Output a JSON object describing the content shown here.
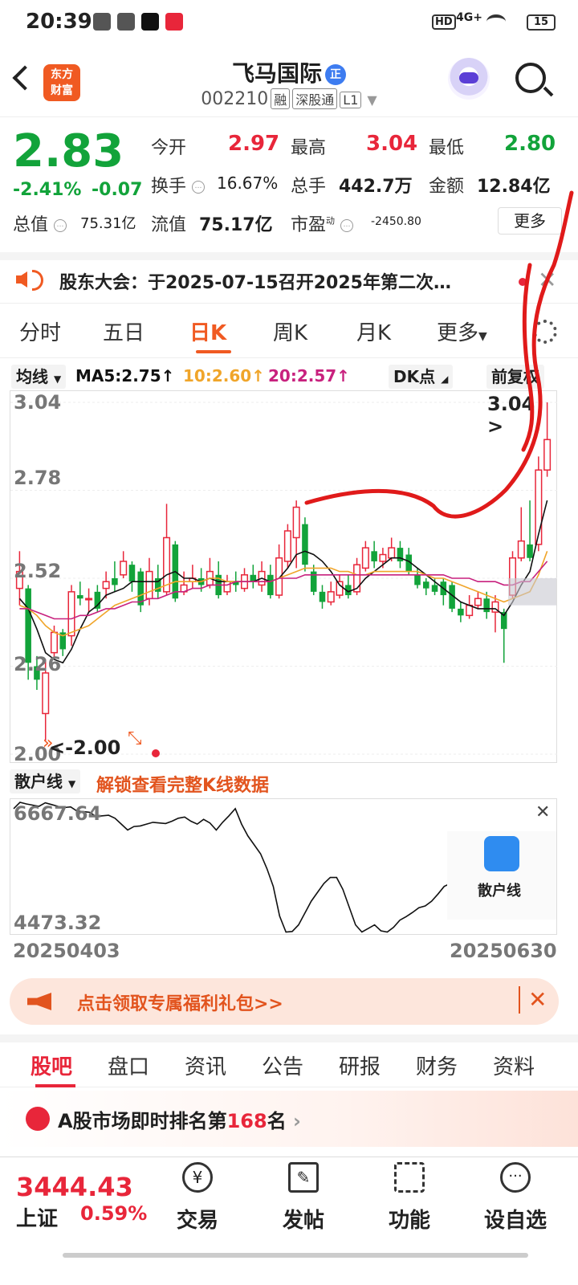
{
  "status_bar": {
    "time": "20:39",
    "network": "4G+",
    "battery": "15"
  },
  "header": {
    "logo_line1": "东方",
    "logo_line2": "财富",
    "stock_name": "飞马国际",
    "badge": "正",
    "stock_code": "002210",
    "tags": [
      "融",
      "深股通",
      "L1"
    ]
  },
  "quote": {
    "price": "2.83",
    "change_pct": "-2.41%",
    "change": "-0.07",
    "open_label": "今开",
    "open": "2.97",
    "high_label": "最高",
    "high": "3.04",
    "low_label": "最低",
    "low": "2.80",
    "turnover_label": "换手",
    "turnover": "16.67%",
    "volume_label": "总手",
    "volume": "442.7万",
    "amount_label": "金额",
    "amount": "12.84亿",
    "mktcap_label": "总值",
    "mktcap": "75.31亿",
    "float_label": "流值",
    "float": "75.17亿",
    "pe_label": "市盈",
    "pe_sup": "动",
    "pe": "-2450.80",
    "more": "更多"
  },
  "notice": {
    "text": "股东大会：于2025-07-15召开2025年第二次…"
  },
  "tabs": [
    "分时",
    "五日",
    "日K",
    "周K",
    "月K",
    "更多"
  ],
  "ma_row": {
    "ma_button": "均线",
    "ma5": "MA5:2.75↑",
    "ma10": "10:2.60↑",
    "ma20": "20:2.57↑",
    "dk": "DK点",
    "adjust": "前复权"
  },
  "colors": {
    "up": "#e8263a",
    "down": "#12a33a",
    "ma5": "#111111",
    "ma10": "#f0a52a",
    "ma20": "#c8217e",
    "accent": "#f05a22"
  },
  "chart_data": {
    "type": "candlestick",
    "y_ticks": [
      "3.04",
      "2.78",
      "2.52",
      "2.26",
      "2.00"
    ],
    "ylim": [
      2.0,
      3.04
    ],
    "high_label": "3.04",
    "low_label": "-2.00",
    "candles": [
      {
        "o": 2.49,
        "c": 2.54,
        "h": 2.6,
        "l": 2.44
      },
      {
        "o": 2.49,
        "c": 2.27,
        "h": 2.5,
        "l": 2.22
      },
      {
        "o": 2.26,
        "c": 2.22,
        "h": 2.29,
        "l": 2.19
      },
      {
        "o": 2.12,
        "c": 2.24,
        "h": 2.28,
        "l": 2.04
      },
      {
        "o": 2.3,
        "c": 2.36,
        "h": 2.38,
        "l": 2.28
      },
      {
        "o": 2.36,
        "c": 2.31,
        "h": 2.37,
        "l": 2.29
      },
      {
        "o": 2.35,
        "c": 2.48,
        "h": 2.5,
        "l": 2.32
      },
      {
        "o": 2.47,
        "c": 2.46,
        "h": 2.51,
        "l": 2.44
      },
      {
        "o": 2.46,
        "c": 2.46,
        "h": 2.49,
        "l": 2.42
      },
      {
        "o": 2.48,
        "c": 2.43,
        "h": 2.5,
        "l": 2.42
      },
      {
        "o": 2.49,
        "c": 2.51,
        "h": 2.54,
        "l": 2.46
      },
      {
        "o": 2.52,
        "c": 2.5,
        "h": 2.57,
        "l": 2.48
      },
      {
        "o": 2.53,
        "c": 2.57,
        "h": 2.6,
        "l": 2.52
      },
      {
        "o": 2.56,
        "c": 2.51,
        "h": 2.57,
        "l": 2.48
      },
      {
        "o": 2.54,
        "c": 2.44,
        "h": 2.55,
        "l": 2.42
      },
      {
        "o": 2.46,
        "c": 2.54,
        "h": 2.58,
        "l": 2.44
      },
      {
        "o": 2.52,
        "c": 2.48,
        "h": 2.56,
        "l": 2.46
      },
      {
        "o": 2.48,
        "c": 2.64,
        "h": 2.74,
        "l": 2.47
      },
      {
        "o": 2.62,
        "c": 2.46,
        "h": 2.63,
        "l": 2.45
      },
      {
        "o": 2.48,
        "c": 2.5,
        "h": 2.54,
        "l": 2.47
      },
      {
        "o": 2.51,
        "c": 2.52,
        "h": 2.56,
        "l": 2.49
      },
      {
        "o": 2.52,
        "c": 2.5,
        "h": 2.55,
        "l": 2.48
      },
      {
        "o": 2.5,
        "c": 2.54,
        "h": 2.58,
        "l": 2.49
      },
      {
        "o": 2.53,
        "c": 2.47,
        "h": 2.57,
        "l": 2.46
      },
      {
        "o": 2.48,
        "c": 2.51,
        "h": 2.53,
        "l": 2.47
      },
      {
        "o": 2.51,
        "c": 2.5,
        "h": 2.54,
        "l": 2.48
      },
      {
        "o": 2.49,
        "c": 2.53,
        "h": 2.55,
        "l": 2.48
      },
      {
        "o": 2.53,
        "c": 2.51,
        "h": 2.56,
        "l": 2.49
      },
      {
        "o": 2.5,
        "c": 2.54,
        "h": 2.57,
        "l": 2.48
      },
      {
        "o": 2.53,
        "c": 2.47,
        "h": 2.56,
        "l": 2.46
      },
      {
        "o": 2.47,
        "c": 2.58,
        "h": 2.62,
        "l": 2.46
      },
      {
        "o": 2.57,
        "c": 2.66,
        "h": 2.68,
        "l": 2.55
      },
      {
        "o": 2.64,
        "c": 2.73,
        "h": 2.75,
        "l": 2.55
      },
      {
        "o": 2.68,
        "c": 2.56,
        "h": 2.7,
        "l": 2.54
      },
      {
        "o": 2.54,
        "c": 2.48,
        "h": 2.56,
        "l": 2.47
      },
      {
        "o": 2.48,
        "c": 2.45,
        "h": 2.5,
        "l": 2.43
      },
      {
        "o": 2.45,
        "c": 2.48,
        "h": 2.51,
        "l": 2.44
      },
      {
        "o": 2.47,
        "c": 2.51,
        "h": 2.53,
        "l": 2.46
      },
      {
        "o": 2.5,
        "c": 2.47,
        "h": 2.53,
        "l": 2.46
      },
      {
        "o": 2.48,
        "c": 2.56,
        "h": 2.58,
        "l": 2.47
      },
      {
        "o": 2.55,
        "c": 2.61,
        "h": 2.63,
        "l": 2.54
      },
      {
        "o": 2.6,
        "c": 2.57,
        "h": 2.63,
        "l": 2.55
      },
      {
        "o": 2.57,
        "c": 2.59,
        "h": 2.61,
        "l": 2.55
      },
      {
        "o": 2.58,
        "c": 2.61,
        "h": 2.64,
        "l": 2.57
      },
      {
        "o": 2.61,
        "c": 2.57,
        "h": 2.63,
        "l": 2.55
      },
      {
        "o": 2.59,
        "c": 2.54,
        "h": 2.61,
        "l": 2.53
      },
      {
        "o": 2.53,
        "c": 2.5,
        "h": 2.55,
        "l": 2.49
      },
      {
        "o": 2.51,
        "c": 2.49,
        "h": 2.52,
        "l": 2.47
      },
      {
        "o": 2.5,
        "c": 2.48,
        "h": 2.52,
        "l": 2.47
      },
      {
        "o": 2.51,
        "c": 2.47,
        "h": 2.52,
        "l": 2.44
      },
      {
        "o": 2.5,
        "c": 2.43,
        "h": 2.51,
        "l": 2.42
      },
      {
        "o": 2.43,
        "c": 2.41,
        "h": 2.45,
        "l": 2.39
      },
      {
        "o": 2.41,
        "c": 2.44,
        "h": 2.47,
        "l": 2.4
      },
      {
        "o": 2.44,
        "c": 2.46,
        "h": 2.48,
        "l": 2.43
      },
      {
        "o": 2.46,
        "c": 2.42,
        "h": 2.48,
        "l": 2.4
      },
      {
        "o": 2.42,
        "c": 2.45,
        "h": 2.47,
        "l": 2.36
      },
      {
        "o": 2.42,
        "c": 2.37,
        "h": 2.43,
        "l": 2.27
      },
      {
        "o": 2.47,
        "c": 2.58,
        "h": 2.6,
        "l": 2.46
      },
      {
        "o": 2.58,
        "c": 2.63,
        "h": 2.73,
        "l": 2.57
      },
      {
        "o": 2.62,
        "c": 2.58,
        "h": 2.75,
        "l": 2.57
      },
      {
        "o": 2.62,
        "c": 2.84,
        "h": 2.88,
        "l": 2.6
      },
      {
        "o": 2.84,
        "c": 2.93,
        "h": 3.04,
        "l": 2.82
      }
    ],
    "ma_series": [
      {
        "name": "MA5",
        "values": [
          2.46,
          2.43,
          2.37,
          2.3,
          2.28,
          2.27,
          2.31,
          2.37,
          2.42,
          2.44,
          2.47,
          2.48,
          2.49,
          2.51,
          2.51,
          2.51,
          2.51,
          2.53,
          2.54,
          2.52,
          2.52,
          2.51,
          2.52,
          2.51,
          2.51,
          2.51,
          2.51,
          2.51,
          2.52,
          2.51,
          2.52,
          2.55,
          2.59,
          2.6,
          2.59,
          2.57,
          2.54,
          2.5,
          2.48,
          2.49,
          2.52,
          2.54,
          2.56,
          2.58,
          2.58,
          2.57,
          2.55,
          2.53,
          2.51,
          2.49,
          2.47,
          2.45,
          2.44,
          2.43,
          2.43,
          2.43,
          2.41,
          2.45,
          2.5,
          2.54,
          2.65,
          2.75
        ]
      },
      {
        "name": "10",
        "values": [
          2.44,
          2.43,
          2.41,
          2.38,
          2.36,
          2.35,
          2.36,
          2.37,
          2.38,
          2.4,
          2.42,
          2.44,
          2.45,
          2.46,
          2.47,
          2.48,
          2.49,
          2.5,
          2.51,
          2.51,
          2.51,
          2.51,
          2.52,
          2.52,
          2.51,
          2.51,
          2.51,
          2.51,
          2.51,
          2.51,
          2.52,
          2.53,
          2.54,
          2.55,
          2.55,
          2.55,
          2.55,
          2.54,
          2.54,
          2.53,
          2.53,
          2.54,
          2.54,
          2.54,
          2.54,
          2.54,
          2.54,
          2.53,
          2.52,
          2.52,
          2.51,
          2.5,
          2.49,
          2.48,
          2.47,
          2.46,
          2.45,
          2.46,
          2.47,
          2.48,
          2.53,
          2.6
        ]
      },
      {
        "name": "20",
        "values": [
          2.43,
          2.43,
          2.42,
          2.41,
          2.4,
          2.4,
          2.4,
          2.41,
          2.41,
          2.42,
          2.43,
          2.43,
          2.44,
          2.45,
          2.45,
          2.46,
          2.46,
          2.47,
          2.48,
          2.48,
          2.49,
          2.49,
          2.5,
          2.5,
          2.5,
          2.51,
          2.51,
          2.51,
          2.51,
          2.51,
          2.52,
          2.52,
          2.52,
          2.53,
          2.53,
          2.53,
          2.53,
          2.53,
          2.53,
          2.53,
          2.53,
          2.53,
          2.53,
          2.53,
          2.53,
          2.53,
          2.53,
          2.53,
          2.53,
          2.53,
          2.52,
          2.52,
          2.52,
          2.51,
          2.51,
          2.51,
          2.5,
          2.5,
          2.51,
          2.51,
          2.54,
          2.57
        ]
      }
    ]
  },
  "sub_indicator": {
    "name": "散户线",
    "unlock_text": "解锁查看完整K线数据",
    "max": "6667.64",
    "min": "4473.32",
    "start_date": "20250403",
    "end_date": "20250630",
    "card_label": "散户线",
    "values": [
      6560,
      6667,
      6640,
      6620,
      6600,
      6660,
      6630,
      6600,
      6580,
      6590,
      6520,
      6510,
      6500,
      6430,
      6440,
      6450,
      6400,
      6300,
      6200,
      6260,
      6270,
      6300,
      6330,
      6320,
      6310,
      6350,
      6400,
      6420,
      6350,
      6300,
      6380,
      6320,
      6200,
      6330,
      6440,
      6560,
      6300,
      6100,
      5950,
      5800,
      5550,
      5250,
      4750,
      4480,
      4490,
      4600,
      4800,
      5000,
      5150,
      5300,
      5400,
      5400,
      5200,
      4900,
      4600,
      4480,
      4540,
      4600,
      4500,
      4480,
      4560,
      4680,
      4740,
      4810,
      4890,
      4920,
      5000,
      5120,
      5250,
      5300,
      5310,
      5400
    ]
  },
  "banner": {
    "text": "点击领取专属福利礼包>>"
  },
  "bottom_tabs": [
    "股吧",
    "盘口",
    "资讯",
    "公告",
    "研报",
    "财务",
    "资料"
  ],
  "rank": {
    "prefix": "A股市场即时排名第",
    "number": "168",
    "suffix": "名"
  },
  "bottom_bar": {
    "index_value": "3444.43",
    "index_name": "上证",
    "index_pct": "0.59%",
    "items": [
      "交易",
      "发帖",
      "功能",
      "设自选"
    ]
  }
}
